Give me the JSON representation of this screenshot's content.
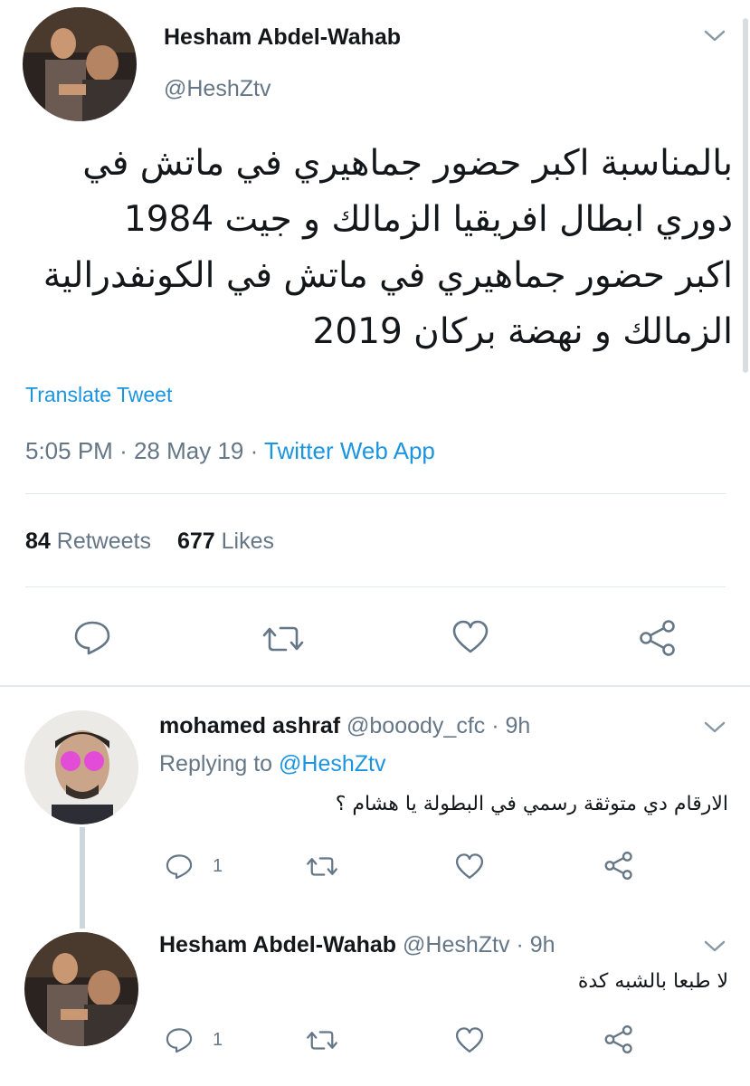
{
  "tweet": {
    "author_name": "Hesham Abdel-Wahab",
    "author_handle": "@HeshZtv",
    "text_lines": [
      "بالمناسبة اكبر حضور جماهيري في ماتش في",
      "دوري ابطال افريقيا الزمالك و جيت 1984",
      "اكبر حضور جماهيري في ماتش في الكونفدرالية",
      "الزمالك و نهضة بركان 2019"
    ],
    "translate_label": "Translate Tweet",
    "time": "5:05 PM",
    "date": "28 May 19",
    "separator": "·",
    "source": "Twitter Web App",
    "retweets_count": "84",
    "retweets_label": "Retweets",
    "likes_count": "677",
    "likes_label": "Likes"
  },
  "replies": [
    {
      "name": "mohamed ashraf",
      "handle": "@booody_cfc",
      "time": "· 9h",
      "replying_prefix": "Replying to",
      "replying_handle": "@HeshZtv",
      "text": "الارقام دي متوثقة رسمي في البطولة يا هشام ؟",
      "reply_count": "1"
    },
    {
      "name": "Hesham Abdel-Wahab",
      "handle": "@HeshZtv",
      "time": "· 9h",
      "text": "لا طبعا بالشبه كدة",
      "reply_count": "1"
    }
  ],
  "icons": [
    "chevron-down-icon",
    "reply-icon",
    "retweet-icon",
    "like-icon",
    "share-icon"
  ],
  "colors": {
    "link": "#1b95e0",
    "muted": "#657786",
    "divider": "#e1e8ed"
  }
}
